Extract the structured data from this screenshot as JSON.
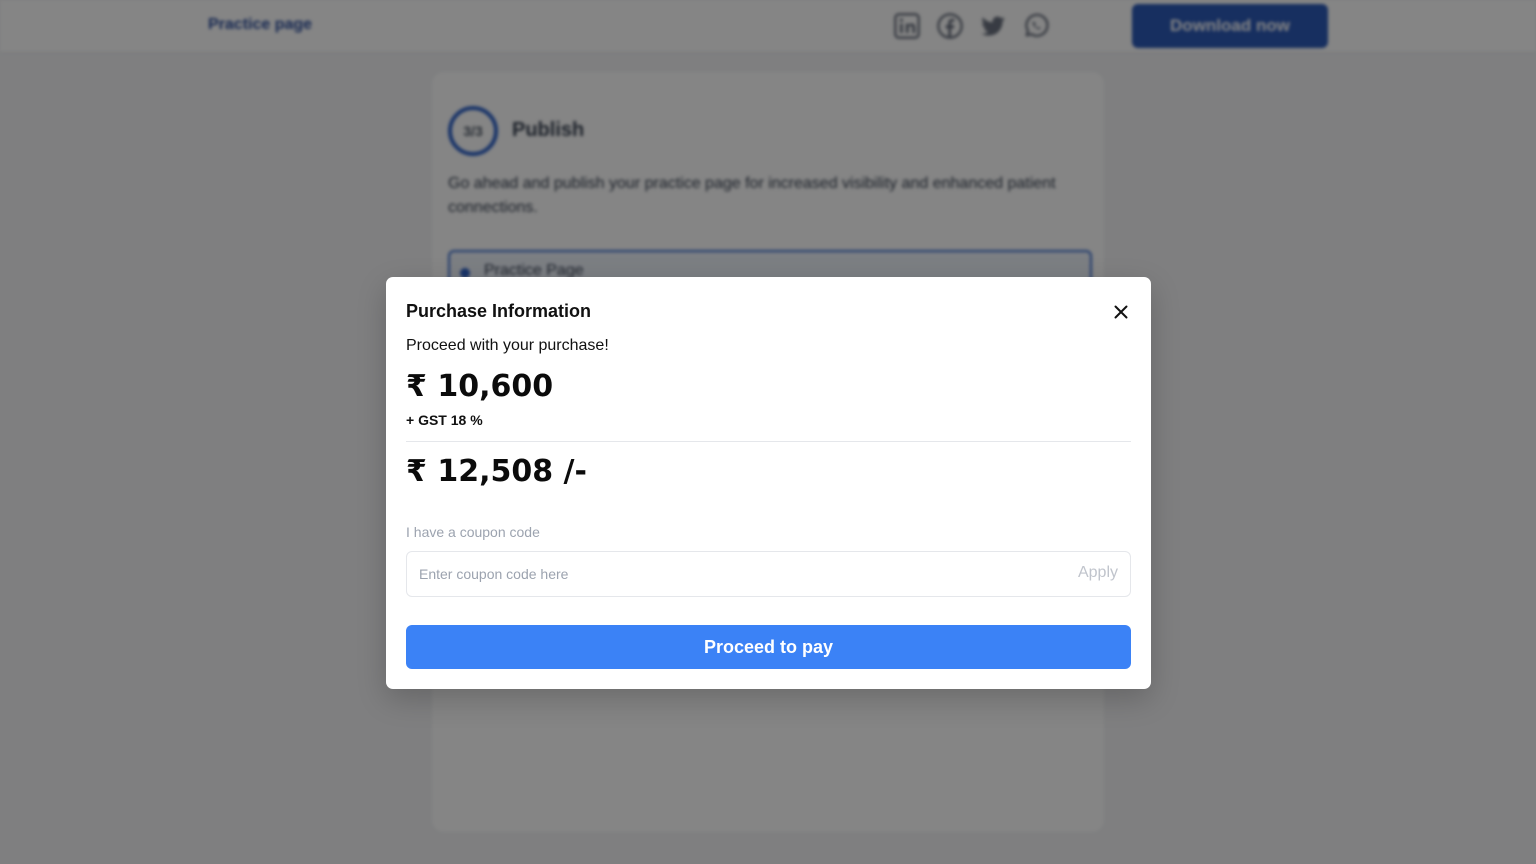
{
  "background": {
    "brand": "Practice page",
    "download_label": "Download now",
    "social_icons": [
      "linkedin-icon",
      "facebook-icon",
      "twitter-icon",
      "whatsapp-icon"
    ],
    "step": {
      "counter": "3/3",
      "title": "Publish",
      "description": "Go ahead and publish your practice page for increased visibility and enhanced patient connections.",
      "option_label": "Practice Page"
    }
  },
  "modal": {
    "title": "Purchase Information",
    "subtitle": "Proceed with your purchase!",
    "price": "₹ 10,600",
    "tax_note": "+ GST 18 %",
    "total": "₹ 12,508 /-",
    "coupon": {
      "label": "I have a coupon code",
      "value": "",
      "placeholder": "Enter coupon code here",
      "apply_label": "Apply"
    },
    "pay_label": "Proceed to pay",
    "close_icon": "close-icon"
  },
  "colors": {
    "accent": "#3b82f6",
    "brand": "#2c5ab8",
    "overlay": "rgba(0,0,0,0.48)"
  }
}
